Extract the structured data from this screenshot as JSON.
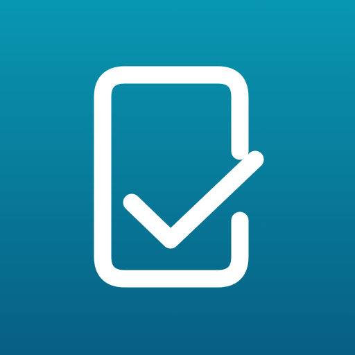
{
  "icon": {
    "name": "checklist-check-icon",
    "shape": "rounded-rectangle-with-checkmark",
    "colors": {
      "background_top": "#0897b1",
      "background_bottom": "#075f84",
      "foreground": "#ffffff"
    }
  }
}
